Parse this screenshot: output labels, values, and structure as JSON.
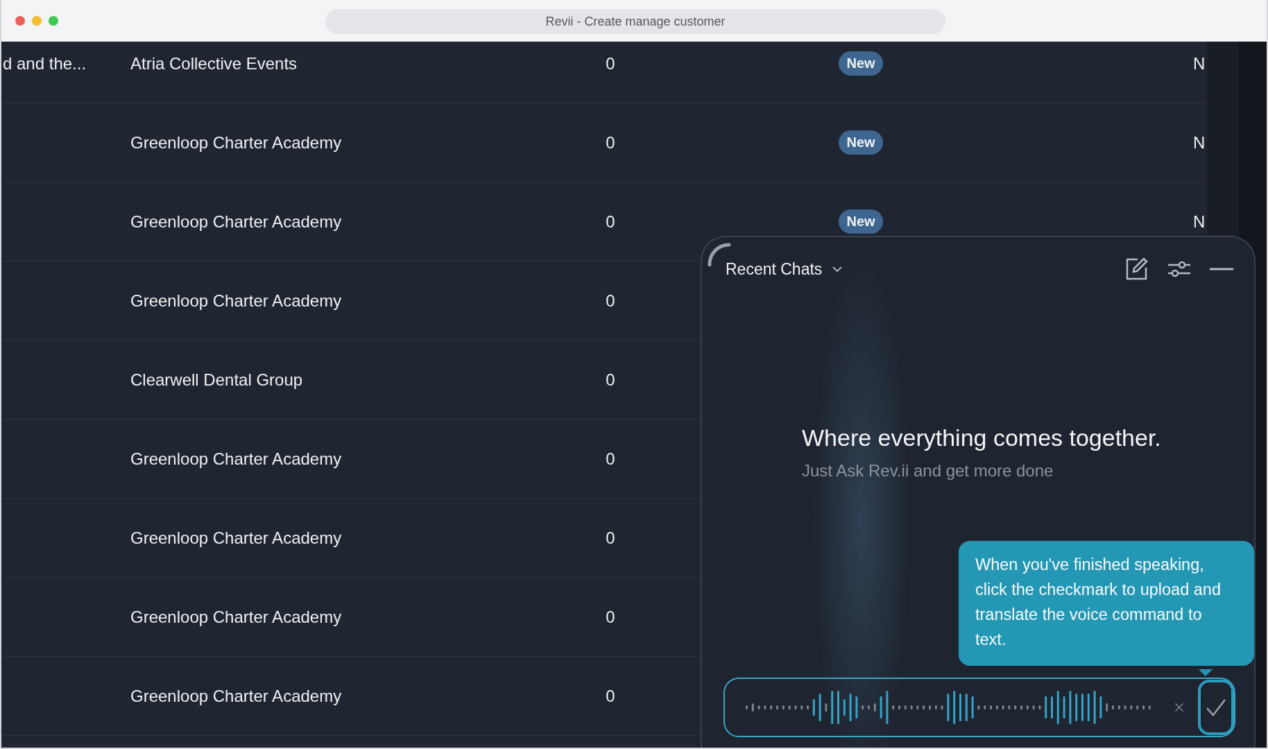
{
  "window": {
    "title": "Revii - Create manage customer"
  },
  "table": {
    "rows": [
      {
        "column_1": "d and the...",
        "name": "Atria Collective Events",
        "count": "0",
        "status": "New",
        "column_5": "N"
      },
      {
        "name": "Greenloop Charter Academy",
        "count": "0",
        "status": "New",
        "column_5": "N"
      },
      {
        "name": "Greenloop Charter Academy",
        "count": "0",
        "status": "New",
        "column_5": "N"
      },
      {
        "name": "Greenloop Charter Academy",
        "count": "0"
      },
      {
        "name": "Clearwell Dental Group",
        "count": "0"
      },
      {
        "name": "Greenloop Charter Academy",
        "count": "0"
      },
      {
        "name": "Greenloop Charter Academy",
        "count": "0"
      },
      {
        "name": "Greenloop Charter Academy",
        "count": "0"
      },
      {
        "name": "Greenloop Charter Academy",
        "count": "0"
      }
    ]
  },
  "chat_panel": {
    "title": "Recent Chats",
    "headline": "Where everything comes together.",
    "subtitle": "Just Ask Rev.ii and get more done",
    "tooltip": "When you've finished speaking, click the checkmark to upload and translate the voice command to text."
  }
}
